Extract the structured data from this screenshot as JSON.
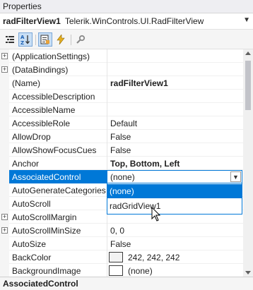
{
  "window": {
    "title": "Properties"
  },
  "object": {
    "name": "radFilterView1",
    "type": "Telerik.WinControls.UI.RadFilterView"
  },
  "toolbar": {
    "buttons": [
      "categorized-icon",
      "alphabetical-icon",
      "properties-icon",
      "events-icon",
      "property-pages-icon"
    ]
  },
  "properties": [
    {
      "name": "(ApplicationSettings)",
      "value": "",
      "expandable": true
    },
    {
      "name": "(DataBindings)",
      "value": "",
      "expandable": true
    },
    {
      "name": "(Name)",
      "value": "radFilterView1"
    },
    {
      "name": "AccessibleDescription",
      "value": ""
    },
    {
      "name": "AccessibleName",
      "value": ""
    },
    {
      "name": "AccessibleRole",
      "value": "Default"
    },
    {
      "name": "AllowDrop",
      "value": "False"
    },
    {
      "name": "AllowShowFocusCues",
      "value": "False"
    },
    {
      "name": "Anchor",
      "value": "Top, Bottom, Left"
    },
    {
      "name": "AssociatedControl",
      "value": "(none)"
    },
    {
      "name": "AutoGenerateCategories",
      "value": ""
    },
    {
      "name": "AutoScroll",
      "value": ""
    },
    {
      "name": "AutoScrollMargin",
      "value": "",
      "expandable": true
    },
    {
      "name": "AutoScrollMinSize",
      "value": "0, 0",
      "expandable": true
    },
    {
      "name": "AutoSize",
      "value": "False"
    },
    {
      "name": "BackColor",
      "value": "242, 242, 242"
    },
    {
      "name": "BackgroundImage",
      "value": "(none)"
    }
  ],
  "dropdown": {
    "options": [
      "(none)",
      "radGridView1"
    ],
    "selected": "(none)"
  },
  "description": {
    "title": "AssociatedControl"
  }
}
